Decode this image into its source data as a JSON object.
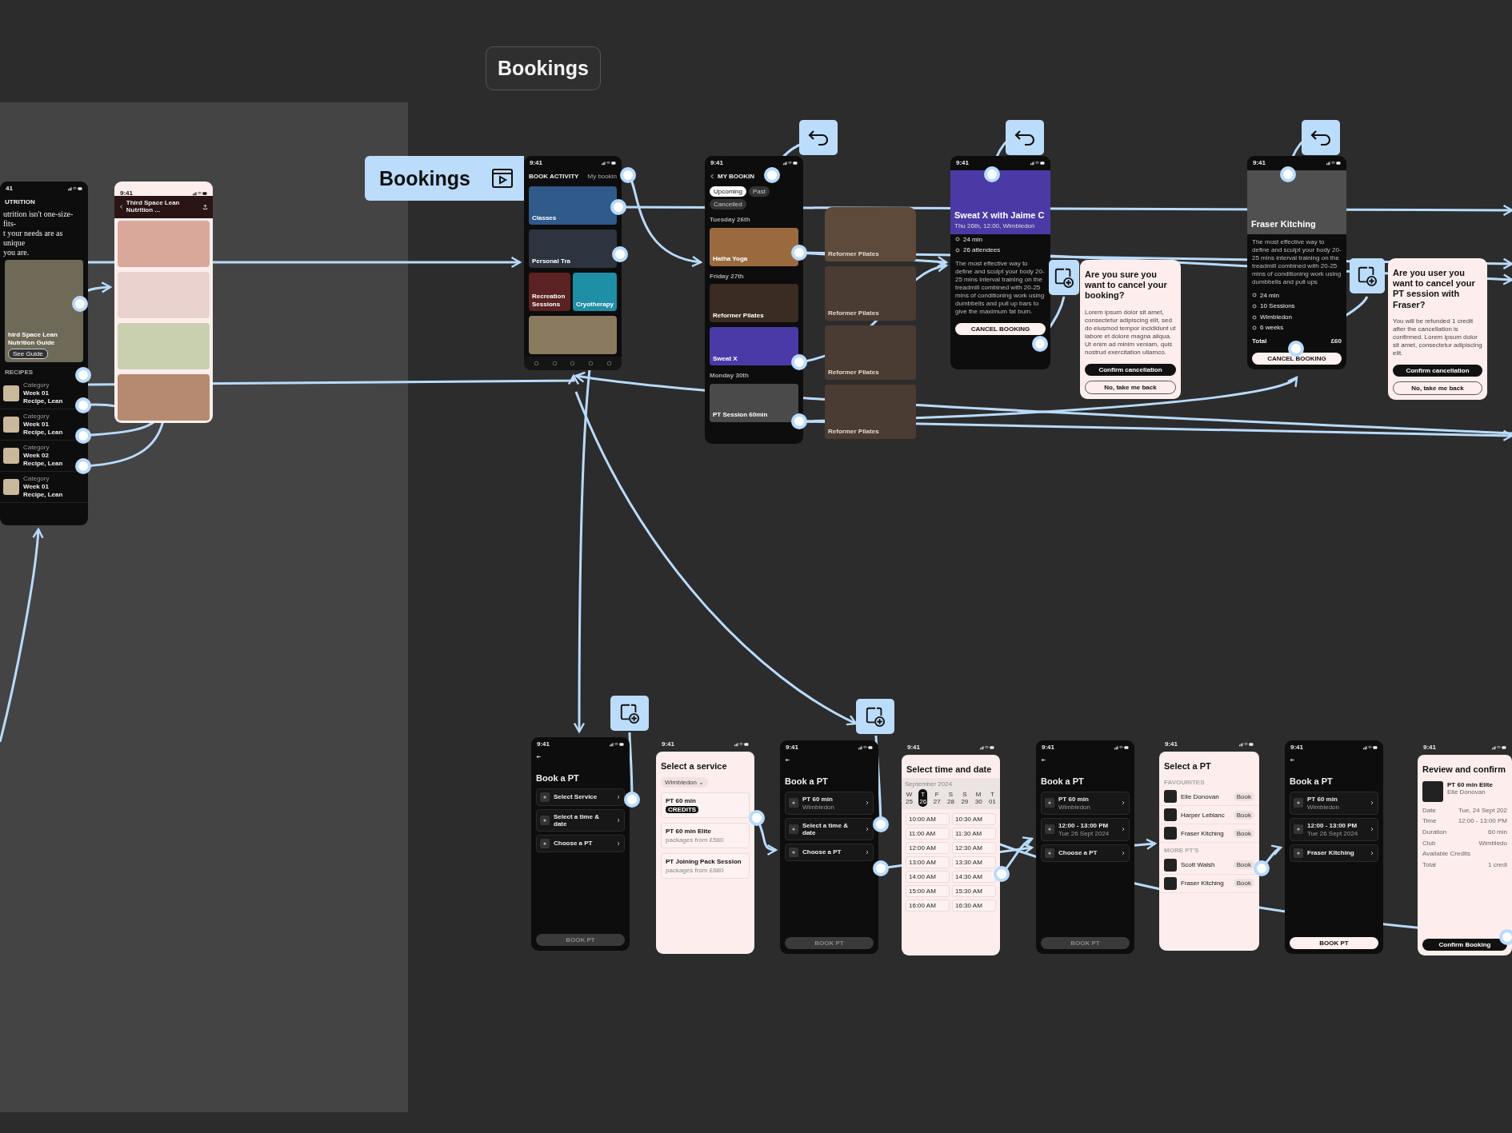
{
  "section_title": "Bookings",
  "flow_start": {
    "label": "Bookings"
  },
  "frames": [
    {
      "kind": "dark",
      "blocks": [
        {
          "kind": "status",
          "time": "41"
        },
        {
          "kind": "nav",
          "text": "UTRITION",
          "back": false
        },
        {
          "kind": "serif",
          "text": "utrition isn't one-size-fits-"
        },
        {
          "kind": "serif",
          "text": "t your needs are as unique"
        },
        {
          "kind": "serif",
          "text": "you are."
        },
        {
          "kind": "photo",
          "color": "#6f6a58",
          "title": "hird Space Lean Nutrition Guide",
          "action": "See Guide"
        },
        {
          "kind": "label",
          "text": "RECIPES"
        },
        {
          "kind": "recipe",
          "category": "Category",
          "title": "Week 01 Recipe, Lean"
        },
        {
          "kind": "recipe",
          "category": "Category",
          "title": "Week 01 Recipe, Lean"
        },
        {
          "kind": "recipe",
          "category": "Category",
          "title": "Week 02 Recipe, Lean"
        },
        {
          "kind": "recipe",
          "category": "Category",
          "title": "Week 01 Recipe, Lean"
        }
      ]
    },
    {
      "kind": "light",
      "blocks": [
        {
          "kind": "status",
          "time": "9:41"
        },
        {
          "kind": "nav",
          "text": "Third Space Lean Nutrition ...",
          "back": true,
          "share": true
        },
        {
          "kind": "photo",
          "color": "#d9a89a"
        },
        {
          "kind": "photo",
          "color": "#ead3cf"
        },
        {
          "kind": "photo",
          "color": "#c9d0b0"
        },
        {
          "kind": "photo",
          "color": "#b58a70"
        }
      ]
    },
    {
      "kind": "dark",
      "blocks": [
        {
          "kind": "status",
          "time": "9:41"
        },
        {
          "kind": "nav",
          "text": "BOOK ACTIVITY",
          "back": false,
          "link": "My bookin"
        },
        {
          "kind": "photo",
          "color": "#2f5a8a",
          "title": "Classes"
        },
        {
          "kind": "photo",
          "color": "#2d3440",
          "title": "Personal Tra"
        },
        {
          "kind": "pair",
          "items": [
            {
              "color": "#5a2222",
              "title": "Recreation Sessions"
            },
            {
              "color": "#1e8fa6",
              "title": "Cryotherapy"
            }
          ]
        },
        {
          "kind": "photo",
          "color": "#8a7a60"
        },
        {
          "kind": "tabbar"
        }
      ]
    },
    {
      "kind": "dark",
      "blocks": [
        {
          "kind": "status",
          "time": "9:41"
        },
        {
          "kind": "nav",
          "text": "MY BOOKIN",
          "back": true
        },
        {
          "kind": "chips",
          "items": [
            {
              "label": "Upcoming",
              "selected": true
            },
            {
              "label": "Past",
              "selected": false
            },
            {
              "label": "Cancelled",
              "selected": false
            }
          ]
        },
        {
          "kind": "label",
          "text": "Tuesday 26th"
        },
        {
          "kind": "photo",
          "color": "#9a6a3e",
          "title": "Hatha Yoga"
        },
        {
          "kind": "label",
          "text": "Friday 27th"
        },
        {
          "kind": "photo",
          "color": "#3a2c22",
          "title": "Reformer Pilates"
        },
        {
          "kind": "photo",
          "color": "#4a3aa8",
          "title": "Sweat X"
        },
        {
          "kind": "label",
          "text": "Monday 30th"
        },
        {
          "kind": "photo",
          "color": "#4a4a4a",
          "title": "PT Session 60min"
        }
      ]
    },
    {
      "kind": "ghost",
      "blocks": [
        {
          "kind": "photo",
          "color": "#5e4a3a",
          "title": "Reformer Pilates"
        },
        {
          "kind": "photo",
          "color": "#4a3c32",
          "title": "Reformer Pilates"
        },
        {
          "kind": "photo",
          "color": "#4a3c32",
          "title": "Reformer Pilates"
        },
        {
          "kind": "photo",
          "color": "#4a3c32",
          "title": "Reformer Pilates"
        }
      ]
    },
    {
      "kind": "dark",
      "blocks": [
        {
          "kind": "status",
          "time": "9:41"
        },
        {
          "kind": "hero",
          "color": "#4b3aa6",
          "title": "Sweat X with Jaime C",
          "sub": "Thu 26th, 12:00, Wimbledon"
        },
        {
          "kind": "stat",
          "text": "24 min"
        },
        {
          "kind": "stat",
          "text": "26 attendees"
        },
        {
          "kind": "para",
          "text": "The most effective way to define and sculpt your body 20-25 mins interval training on the treadmill combined with 20-25 mins of conditioning work using dumbbells and pull up bars to give the maximum fat burn."
        },
        {
          "kind": "button",
          "text": "CANCEL BOOKING"
        }
      ]
    },
    {
      "kind": "light",
      "blocks": [
        {
          "kind": "heading",
          "text": "Are you sure you want to cancel your booking?"
        },
        {
          "kind": "para",
          "text": "Lorem ipsum dolor sit amet, consectetur adipiscing elit, sed do eiusmod tempor incididunt ut labore et dolore magna aliqua. Ut enim ad minim veniam, quis nostrud exercitation ullamco."
        },
        {
          "kind": "button",
          "text": "Confirm cancellation"
        },
        {
          "kind": "button-outline",
          "text": "No, take me back"
        }
      ]
    },
    {
      "kind": "dark",
      "blocks": [
        {
          "kind": "status",
          "time": "9:41"
        },
        {
          "kind": "hero",
          "color": "#505050",
          "title": "Fraser Kitching"
        },
        {
          "kind": "para",
          "text": "The most effective way to define and sculpt your body 20-25 mins interval training on the treadmill combined with 20-25 mins of conditioning work using dumbbells and pull ups"
        },
        {
          "kind": "stat",
          "text": "24 min"
        },
        {
          "kind": "stat",
          "text": "10 Sessions"
        },
        {
          "kind": "stat",
          "text": "Wimbledon"
        },
        {
          "kind": "stat",
          "text": "6 weeks"
        },
        {
          "kind": "kv",
          "label": "Total",
          "value": "£60"
        },
        {
          "kind": "button",
          "text": "CANCEL BOOKING"
        }
      ]
    },
    {
      "kind": "light",
      "blocks": [
        {
          "kind": "heading",
          "text": "Are you user you want to cancel your PT session with Fraser?"
        },
        {
          "kind": "para",
          "text": "You will be refunded 1 credit after the cancellation is confirmed. Lorem ipsum dolor sit amet, consectetur adipiscing elit."
        },
        {
          "kind": "button",
          "text": "Confirm cancellation"
        },
        {
          "kind": "button-outline",
          "text": "No, take me back"
        }
      ]
    },
    {
      "kind": "dark",
      "blocks": [
        {
          "kind": "status",
          "time": "9:41"
        },
        {
          "kind": "back"
        },
        {
          "kind": "heading",
          "text": "Book a PT"
        },
        {
          "kind": "row",
          "title": "Select Service"
        },
        {
          "kind": "row",
          "title": "Select a time & date"
        },
        {
          "kind": "row",
          "title": "Choose a PT"
        },
        {
          "kind": "spacer"
        },
        {
          "kind": "button",
          "text": "BOOK PT",
          "disabled": true
        }
      ]
    },
    {
      "kind": "sheet",
      "blocks": [
        {
          "kind": "status",
          "time": "9:41"
        },
        {
          "kind": "heading",
          "text": "Select a service"
        },
        {
          "kind": "chips",
          "items": [
            {
              "label": "Wimbledon ⌄",
              "selected": false
            }
          ]
        },
        {
          "kind": "option",
          "title": "PT 60 min",
          "tag": "CREDITS"
        },
        {
          "kind": "option",
          "title": "PT 60 min Elite",
          "sub": "packages from £580"
        },
        {
          "kind": "option",
          "title": "PT Joining Pack Session",
          "sub": "packages from £680"
        },
        {
          "kind": "spacer"
        }
      ]
    },
    {
      "kind": "dark",
      "blocks": [
        {
          "kind": "status",
          "time": "9:41"
        },
        {
          "kind": "back"
        },
        {
          "kind": "heading",
          "text": "Book a PT"
        },
        {
          "kind": "row",
          "title": "PT 60 min",
          "sub": "Wimbledon"
        },
        {
          "kind": "row",
          "title": "Select a time & date"
        },
        {
          "kind": "row",
          "title": "Choose a PT"
        },
        {
          "kind": "spacer"
        },
        {
          "kind": "button",
          "text": "BOOK PT",
          "disabled": true
        }
      ]
    },
    {
      "kind": "sheet",
      "blocks": [
        {
          "kind": "status",
          "time": "9:41"
        },
        {
          "kind": "heading",
          "text": "Select time and date"
        },
        {
          "kind": "days",
          "month": "September 2024",
          "items": [
            {
              "weekday": "W",
              "date": "25",
              "selected": false
            },
            {
              "weekday": "T",
              "date": "26",
              "selected": true
            },
            {
              "weekday": "F",
              "date": "27",
              "selected": false
            },
            {
              "weekday": "S",
              "date": "28",
              "selected": false
            },
            {
              "weekday": "S",
              "date": "29",
              "selected": false
            },
            {
              "weekday": "M",
              "date": "30",
              "selected": false
            },
            {
              "weekday": "T",
              "date": "01",
              "selected": false
            }
          ]
        },
        {
          "kind": "times",
          "items": [
            "10:00 AM",
            "10:30 AM",
            "11:00 AM",
            "11:30 AM",
            "12:00 AM",
            "12:30 AM",
            "13:00 AM",
            "13:30 AM",
            "14:00 AM",
            "14:30 AM",
            "15:00 AM",
            "15:30 AM",
            "16:00 AM",
            "16:30 AM"
          ]
        }
      ]
    },
    {
      "kind": "dark",
      "blocks": [
        {
          "kind": "status",
          "time": "9:41"
        },
        {
          "kind": "back"
        },
        {
          "kind": "heading",
          "text": "Book a PT"
        },
        {
          "kind": "row",
          "title": "PT 60 min",
          "sub": "Wimbledon"
        },
        {
          "kind": "row",
          "title": "12:00 - 13:00 PM",
          "sub": "Tue 26 Sept 2024"
        },
        {
          "kind": "row",
          "title": "Choose a PT"
        },
        {
          "kind": "spacer"
        },
        {
          "kind": "button",
          "text": "BOOK PT",
          "disabled": true
        }
      ]
    },
    {
      "kind": "sheet",
      "blocks": [
        {
          "kind": "status",
          "time": "9:41"
        },
        {
          "kind": "heading",
          "text": "Select a PT"
        },
        {
          "kind": "label",
          "text": "FAVOURITES"
        },
        {
          "kind": "person",
          "name": "Elle Donovan",
          "action": "Book"
        },
        {
          "kind": "person",
          "name": "Harper Leblanc",
          "action": "Book"
        },
        {
          "kind": "person",
          "name": "Fraser Kitching",
          "action": "Book"
        },
        {
          "kind": "label",
          "text": "MORE PT'S"
        },
        {
          "kind": "person",
          "name": "Scott Walsh",
          "action": "Book"
        },
        {
          "kind": "person",
          "name": "Fraser Kitching",
          "action": "Book"
        }
      ]
    },
    {
      "kind": "dark",
      "blocks": [
        {
          "kind": "status",
          "time": "9:41"
        },
        {
          "kind": "back"
        },
        {
          "kind": "heading",
          "text": "Book a PT"
        },
        {
          "kind": "row",
          "title": "PT 60 min",
          "sub": "Wimbledon"
        },
        {
          "kind": "row",
          "title": "12:00 - 13:00 PM",
          "sub": "Tue 26 Sept 2024"
        },
        {
          "kind": "row",
          "title": "Fraser Kitching"
        },
        {
          "kind": "spacer"
        },
        {
          "kind": "button",
          "text": "BOOK PT",
          "disabled": false
        }
      ]
    },
    {
      "kind": "sheet",
      "blocks": [
        {
          "kind": "status",
          "time": "9:41"
        },
        {
          "kind": "heading",
          "text": "Review and confirm"
        },
        {
          "kind": "summary",
          "title": "PT 60 min Elite",
          "sub": "Elle Donovan"
        },
        {
          "kind": "kv",
          "label": "Date",
          "value": "Tue, 24 Sept 202"
        },
        {
          "kind": "kv",
          "label": "Time",
          "value": "12:00 - 13:00 PM"
        },
        {
          "kind": "kv",
          "label": "Duration",
          "value": "60 min"
        },
        {
          "kind": "kv",
          "label": "Club",
          "value": "Wimbledo"
        },
        {
          "kind": "kv",
          "label": "Available Credits"
        },
        {
          "kind": "kv",
          "label": "Total",
          "value": "1 credi"
        },
        {
          "kind": "spacer"
        },
        {
          "kind": "button",
          "text": "Confirm Booking"
        }
      ]
    }
  ]
}
